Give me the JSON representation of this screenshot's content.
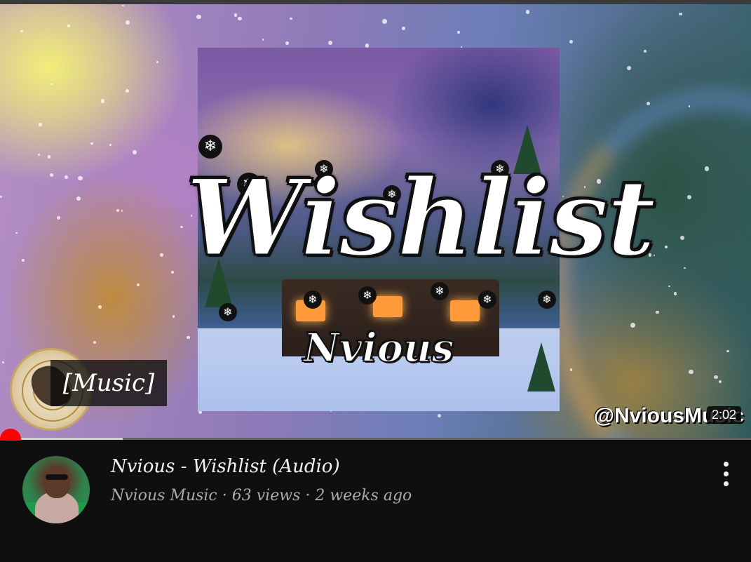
{
  "player": {
    "thumbnail": {
      "artwork_title": "Wishlist",
      "artwork_artist": "Nvious",
      "watermark": "@NviousMusic"
    },
    "caption": "[Music]",
    "duration": "2:02",
    "progress": {
      "played_fraction": 0.0,
      "buffered_fraction": 0.163
    }
  },
  "video": {
    "title": "Nvious - Wishlist (Audio)",
    "channel": "Nvious Music",
    "views": "63 views",
    "age": "2 weeks ago",
    "separator": "·"
  },
  "icons": {
    "more": "more-vert-icon",
    "snowflake": "snowflake-icon"
  },
  "colors": {
    "accent": "#ff0000",
    "background": "#0f0f0f",
    "title_text": "#f1f1f1",
    "meta_text": "#aaaaaa"
  }
}
